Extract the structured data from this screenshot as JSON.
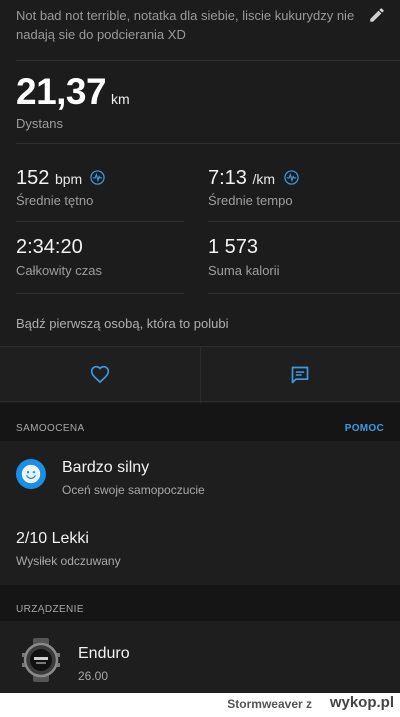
{
  "note": {
    "text": "Not bad not terrible, notatka dla siebie, liscie kukurydzy nie nadają sie do podcierania XD"
  },
  "distance": {
    "value": "21,37",
    "unit": "km",
    "label": "Dystans"
  },
  "stats": {
    "heart_rate": {
      "value": "152",
      "unit": "bpm",
      "label": "Średnie tętno"
    },
    "pace": {
      "value": "7:13",
      "unit": "/km",
      "label": "Średnie tempo"
    },
    "total_time": {
      "value": "2:34:20",
      "label": "Całkowity czas"
    },
    "calories": {
      "value": "1 573",
      "label": "Suma kalorii"
    }
  },
  "likes_text": "Bądź pierwszą osobą, która to polubi",
  "self_eval": {
    "section_title": "SAMOOCENA",
    "help_label": "POMOC",
    "feel_title": "Bardzo silny",
    "feel_subtitle": "Oceń swoje samopoczucie",
    "effort_title": "2/10 Lekki",
    "effort_subtitle": "Wysiłek odczuwany"
  },
  "device": {
    "section_title": "URZĄDZENIE",
    "name": "Enduro",
    "version": "26.00"
  },
  "footer": {
    "credit": "Stormweaver z",
    "brand": "wykop.pl"
  },
  "colors": {
    "accent": "#3d9be6",
    "background": "#1c1c1c"
  }
}
